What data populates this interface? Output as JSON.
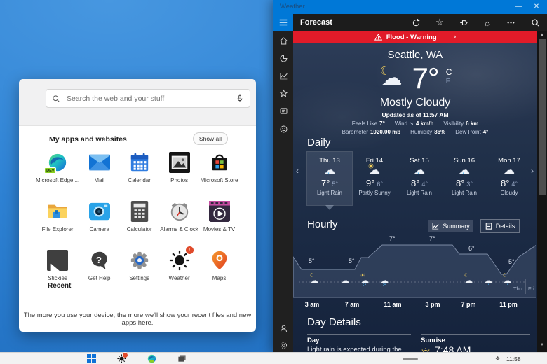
{
  "launcher": {
    "search_placeholder": "Search the web and your stuff",
    "apps_heading": "My apps and websites",
    "show_all_label": "Show all",
    "apps": [
      {
        "label": "Microsoft Edge ...",
        "badge": "DEV"
      },
      {
        "label": "Mail"
      },
      {
        "label": "Calendar"
      },
      {
        "label": "Photos"
      },
      {
        "label": "Microsoft Store"
      },
      {
        "label": "File Explorer"
      },
      {
        "label": "Camera"
      },
      {
        "label": "Calculator"
      },
      {
        "label": "Alarms & Clock"
      },
      {
        "label": "Movies & TV"
      },
      {
        "label": "Stickies"
      },
      {
        "label": "Get Help"
      },
      {
        "label": "Settings"
      },
      {
        "label": "Weather",
        "badge": "!"
      },
      {
        "label": "Maps"
      }
    ],
    "recent_heading": "Recent",
    "recent_hint": "The more you use your device, the more we'll show your recent files and new apps here."
  },
  "weather": {
    "window_title": "Weather",
    "minimize_glyph": "—",
    "close_glyph": "✕",
    "toolbar_title": "Forecast",
    "more_glyph": "•••",
    "alert_label": "Flood - Warning",
    "alert_chevron": "›",
    "location": "Seattle, WA",
    "temperature": "7°",
    "unit_c": "C",
    "unit_f": "F",
    "condition": "Mostly Cloudy",
    "updated": "Updated as of 11:57 AM",
    "details": {
      "feels_like_label": "Feels Like",
      "feels_like": "7°",
      "wind_label": "Wind",
      "wind_arrow": "↘",
      "wind": "4 km/h",
      "visibility_label": "Visibility",
      "visibility": "6 km",
      "barometer_label": "Barometer",
      "barometer": "1020.00 mb",
      "humidity_label": "Humidity",
      "humidity": "86%",
      "dew_label": "Dew Point",
      "dew": "4°"
    },
    "daily_heading": "Daily",
    "daily_prev": "‹",
    "daily_next": "›",
    "daily": [
      {
        "day": "Thu 13",
        "high": "7°",
        "low": "5°",
        "condition": "Light Rain"
      },
      {
        "day": "Fri 14",
        "high": "9°",
        "low": "6°",
        "condition": "Partly Sunny"
      },
      {
        "day": "Sat 15",
        "high": "8°",
        "low": "4°",
        "condition": "Light Rain"
      },
      {
        "day": "Sun 16",
        "high": "8°",
        "low": "3°",
        "condition": "Light Rain"
      },
      {
        "day": "Mon 17",
        "high": "8°",
        "low": "4°",
        "condition": "Cloudy"
      }
    ],
    "hourly_heading": "Hourly",
    "summary_label": "Summary",
    "details_label": "Details",
    "hourly": {
      "temp_labels": [
        "5°",
        "5°",
        "7°",
        "7°",
        "6°",
        "5°"
      ],
      "temps_c": [
        5,
        5,
        7,
        7,
        6,
        5
      ],
      "time_labels": [
        "3 am",
        "7 am",
        "11 am",
        "3 pm",
        "7 pm",
        "11 pm"
      ],
      "day_left": "Thu",
      "day_right": "Fri"
    },
    "day_details_heading": "Day Details",
    "day_label": "Day",
    "day_text": "Light rain is expected during the day. The",
    "sunrise_label": "Sunrise",
    "sunrise_time": "7:48 AM"
  },
  "taskbar": {
    "time": "11:58"
  }
}
